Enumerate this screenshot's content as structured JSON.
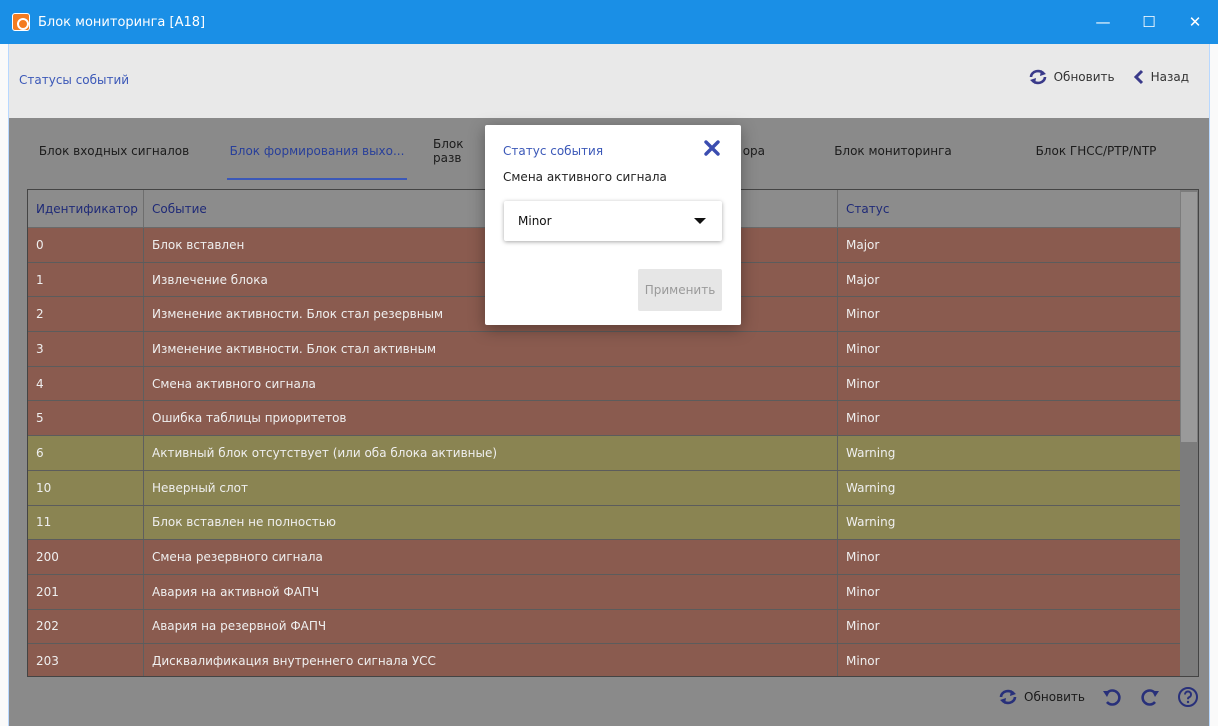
{
  "window": {
    "title": "Блок мониторинга [A18]",
    "accent": "#1a8fe6",
    "controls": {
      "minimize": "—",
      "maximize": "☐",
      "close": "✕"
    }
  },
  "header": {
    "breadcrumb": "Статусы событий",
    "refresh_label": "Обновить",
    "back_label": "Назад"
  },
  "tabs": [
    {
      "label": "Блок входных сигналов",
      "active": false
    },
    {
      "label": "Блок формирования выхо...",
      "active": true
    },
    {
      "label": "Блок разв",
      "active": false
    },
    {
      "label": "ора",
      "active": false
    },
    {
      "label": "Блок мониторинга",
      "active": false
    },
    {
      "label": "Блок ГНСС/PTP/NTP",
      "active": false
    }
  ],
  "table": {
    "columns": [
      "Идентификатор",
      "Событие",
      "Статус"
    ],
    "rows": [
      {
        "id": "0",
        "event": "Блок вставлен",
        "status": "Major"
      },
      {
        "id": "1",
        "event": "Извлечение блока",
        "status": "Major"
      },
      {
        "id": "2",
        "event": "Изменение активности. Блок стал резервным",
        "status": "Minor"
      },
      {
        "id": "3",
        "event": "Изменение активности. Блок стал активным",
        "status": "Minor"
      },
      {
        "id": "4",
        "event": "Смена активного сигнала",
        "status": "Minor"
      },
      {
        "id": "5",
        "event": "Ошибка таблицы приоритетов",
        "status": "Minor"
      },
      {
        "id": "6",
        "event": "Активный блок отсутствует (или оба блока активные)",
        "status": "Warning"
      },
      {
        "id": "10",
        "event": "Неверный слот",
        "status": "Warning"
      },
      {
        "id": "11",
        "event": "Блок вставлен не полностью",
        "status": "Warning"
      },
      {
        "id": "200",
        "event": "Смена резервного сигнала",
        "status": "Minor"
      },
      {
        "id": "201",
        "event": "Авария на активной ФАПЧ",
        "status": "Minor"
      },
      {
        "id": "202",
        "event": "Авария на резервной ФАПЧ",
        "status": "Minor"
      },
      {
        "id": "203",
        "event": "Дисквалификация внутреннего сигнала УСС",
        "status": "Minor"
      }
    ]
  },
  "footer": {
    "refresh_label": "Обновить"
  },
  "dialog": {
    "title": "Статус события",
    "subtitle": "Смена активного сигнала",
    "selected": "Minor",
    "apply_label": "Применить"
  }
}
